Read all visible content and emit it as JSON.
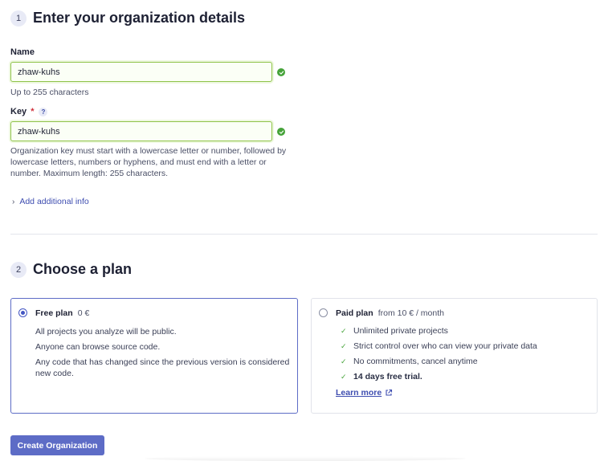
{
  "step1": {
    "number": "1",
    "title": "Enter your organization details"
  },
  "name_field": {
    "label": "Name",
    "value": "zhaw-kuhs",
    "hint": "Up to 255 characters"
  },
  "key_field": {
    "label": "Key",
    "required_mark": "*",
    "help_glyph": "?",
    "value": "zhaw-kuhs",
    "hint": "Organization key must start with a lowercase letter or number, followed by lowercase letters, numbers or hyphens, and must end with a letter or number. Maximum length: 255 characters."
  },
  "additional_info_link": "Add additional info",
  "step2": {
    "number": "2",
    "title": "Choose a plan"
  },
  "free_plan": {
    "name": "Free plan",
    "price": "0 €",
    "selected": true,
    "lines": [
      "All projects you analyze will be public.",
      "Anyone can browse source code.",
      "Any code that has changed since the previous version is considered new code."
    ]
  },
  "paid_plan": {
    "name": "Paid plan",
    "price": "from 10 € / month",
    "selected": false,
    "features": [
      "Unlimited private projects",
      "Strict control over who can view your private data",
      "No commitments, cancel anytime",
      "14 days free trial."
    ],
    "learn_more": "Learn more"
  },
  "create_button": "Create Organization",
  "colors": {
    "accent": "#5d6cc6",
    "valid_border": "#8fc34a",
    "success": "#46a33a",
    "link": "#3e4db0"
  }
}
